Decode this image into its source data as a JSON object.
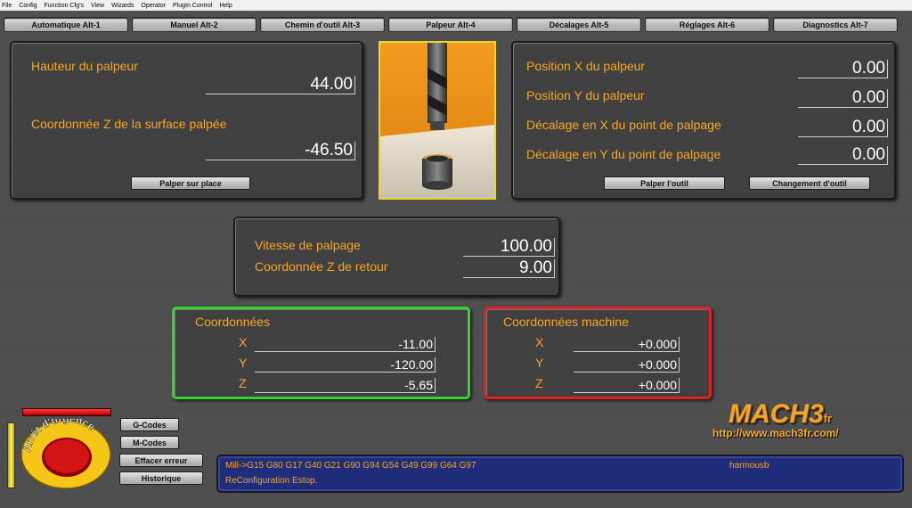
{
  "menu": [
    "File",
    "Config",
    "Function Cfg's",
    "View",
    "Wizards",
    "Operator",
    "PlugIn Control",
    "Help"
  ],
  "tabs": [
    "Automatique Alt-1",
    "Manuel Alt-2",
    "Chemin d'outil Alt-3",
    "Palpeur Alt-4",
    "Décalages Alt-5",
    "Réglages Alt-6",
    "Diagnostics Alt-7"
  ],
  "probe_left": {
    "height_label": "Hauteur du palpeur",
    "height_value": "44.00",
    "surface_label": "Coordonnée Z de la surface palpée",
    "surface_value": "-46.50",
    "button": "Palper sur place"
  },
  "probe_right": {
    "rows": [
      {
        "label": "Position X du palpeur",
        "value": "0.00"
      },
      {
        "label": "Position Y du palpeur",
        "value": "0.00"
      },
      {
        "label": "Décalage en X du point de palpage",
        "value": "0.00"
      },
      {
        "label": "Décalage en Y du point de palpage",
        "value": "0.00"
      }
    ],
    "button_tool": "Palper l'outil",
    "button_change": "Changement d'outil"
  },
  "speed": {
    "speed_label": "Vitesse de palpage",
    "speed_value": "100.00",
    "return_label": "Coordonnée Z de retour",
    "return_value": "9.00"
  },
  "coords": {
    "title": "Coordonnées",
    "axes": [
      {
        "axis": "X",
        "value": "-11.00"
      },
      {
        "axis": "Y",
        "value": "-120.00"
      },
      {
        "axis": "Z",
        "value": "-5.65"
      }
    ]
  },
  "machine": {
    "title": "Coordonnées machine",
    "axes": [
      {
        "axis": "X",
        "value": "+0.000"
      },
      {
        "axis": "Y",
        "value": "+0.000"
      },
      {
        "axis": "Z",
        "value": "+0.000"
      }
    ]
  },
  "estop_label": "Arrêt d'urgence",
  "side_buttons": [
    "G-Codes",
    "M-Codes",
    "Effacer erreur",
    "Historique"
  ],
  "logo": {
    "name": "MACH3",
    "suffix": "fr",
    "url": "http://www.mach3fr.com/"
  },
  "status": {
    "gcode_line": "Mill->G15  G80 G17 G40 G21 G90 G94 G54 G49 G99 G64 G97",
    "user": "harmousb",
    "message": "ReConfiguration Estop."
  },
  "colors": {
    "accent_orange": "#f5a623",
    "coords_border": "#2fd62f",
    "machine_border": "#e02020",
    "status_border": "#2a3a8a"
  }
}
